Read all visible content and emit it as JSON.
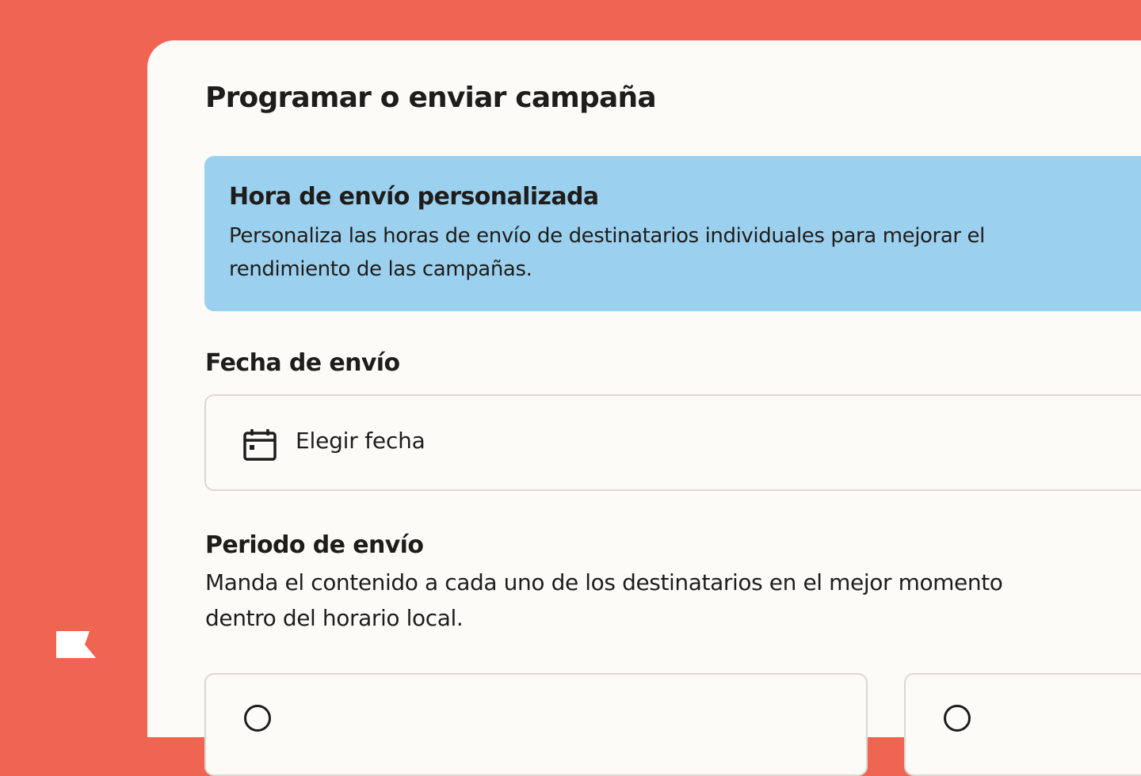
{
  "brand": {
    "logo_icon": "flag-logo-icon",
    "sidebar_color": "#f06552",
    "banner_color": "#9bd0ee"
  },
  "page": {
    "title": "Programar o enviar campaña"
  },
  "banner": {
    "title": "Hora de envío personalizada",
    "description": "Personaliza las horas de envío de destinatarios individuales para mejorar el rendimiento de las campañas."
  },
  "send_date": {
    "label": "Fecha de envío",
    "icon": "calendar-icon",
    "placeholder": "Elegir fecha"
  },
  "send_period": {
    "label": "Periodo de envío",
    "description": "Manda el contenido a cada uno de los destinatarios en el mejor momento dentro del horario local.",
    "options": [
      {
        "icon": "radio-icon"
      },
      {
        "icon": "radio-icon"
      }
    ]
  }
}
